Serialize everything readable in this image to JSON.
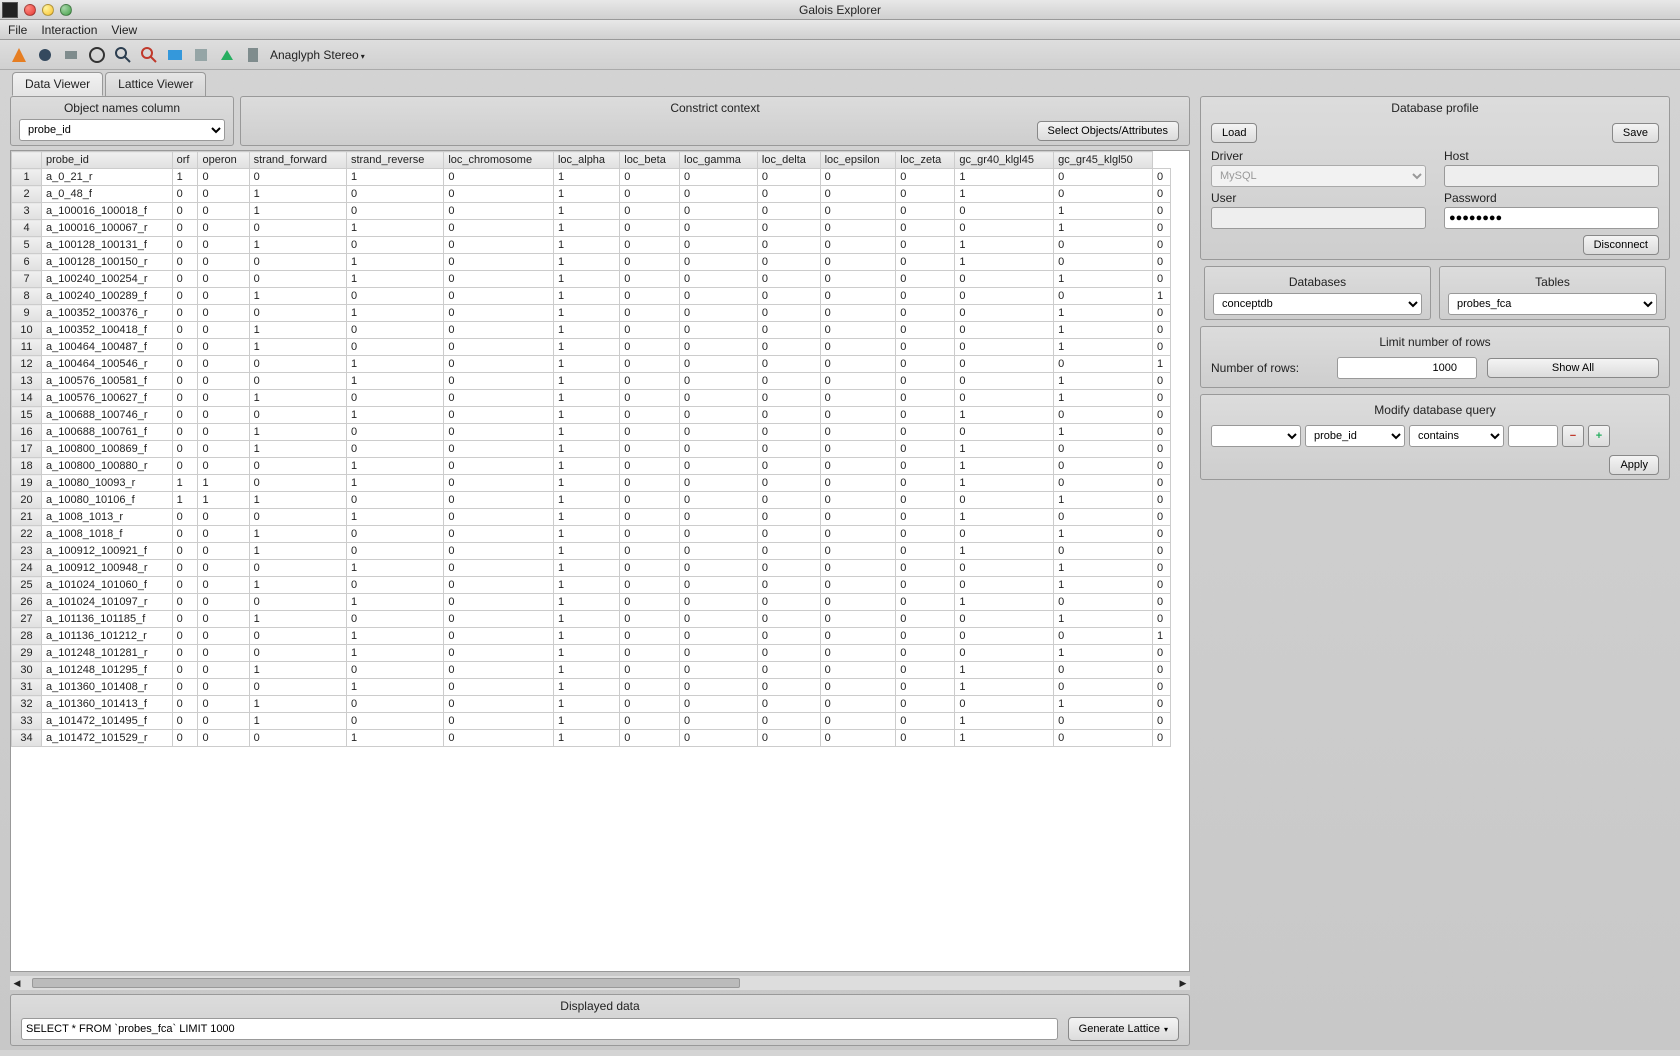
{
  "title": "Galois Explorer",
  "menus": [
    "File",
    "Interaction",
    "View"
  ],
  "toolbar_label": "Anaglyph Stereo",
  "tabs": [
    {
      "label": "Data Viewer",
      "active": true
    },
    {
      "label": "Lattice Viewer",
      "active": false
    }
  ],
  "object_names": {
    "label": "Object names column",
    "value": "probe_id"
  },
  "constrict": {
    "label": "Constrict context",
    "button": "Select Objects/Attributes"
  },
  "grid": {
    "columns": [
      "probe_id",
      "orf",
      "operon",
      "strand_forward",
      "strand_reverse",
      "loc_chromosome",
      "loc_alpha",
      "loc_beta",
      "loc_gamma",
      "loc_delta",
      "loc_epsilon",
      "loc_zeta",
      "gc_gr40_klgl45",
      "gc_gr45_klgl50"
    ],
    "rows": [
      [
        "a_0_21_r",
        "1",
        "0",
        "0",
        "1",
        "0",
        "1",
        "0",
        "0",
        "0",
        "0",
        "0",
        "1",
        "0",
        "0"
      ],
      [
        "a_0_48_f",
        "0",
        "0",
        "1",
        "0",
        "0",
        "1",
        "0",
        "0",
        "0",
        "0",
        "0",
        "1",
        "0",
        "0"
      ],
      [
        "a_100016_100018_f",
        "0",
        "0",
        "1",
        "0",
        "0",
        "1",
        "0",
        "0",
        "0",
        "0",
        "0",
        "0",
        "1",
        "0"
      ],
      [
        "a_100016_100067_r",
        "0",
        "0",
        "0",
        "1",
        "0",
        "1",
        "0",
        "0",
        "0",
        "0",
        "0",
        "0",
        "1",
        "0"
      ],
      [
        "a_100128_100131_f",
        "0",
        "0",
        "1",
        "0",
        "0",
        "1",
        "0",
        "0",
        "0",
        "0",
        "0",
        "1",
        "0",
        "0"
      ],
      [
        "a_100128_100150_r",
        "0",
        "0",
        "0",
        "1",
        "0",
        "1",
        "0",
        "0",
        "0",
        "0",
        "0",
        "1",
        "0",
        "0"
      ],
      [
        "a_100240_100254_r",
        "0",
        "0",
        "0",
        "1",
        "0",
        "1",
        "0",
        "0",
        "0",
        "0",
        "0",
        "0",
        "1",
        "0"
      ],
      [
        "a_100240_100289_f",
        "0",
        "0",
        "1",
        "0",
        "0",
        "1",
        "0",
        "0",
        "0",
        "0",
        "0",
        "0",
        "0",
        "1"
      ],
      [
        "a_100352_100376_r",
        "0",
        "0",
        "0",
        "1",
        "0",
        "1",
        "0",
        "0",
        "0",
        "0",
        "0",
        "0",
        "1",
        "0"
      ],
      [
        "a_100352_100418_f",
        "0",
        "0",
        "1",
        "0",
        "0",
        "1",
        "0",
        "0",
        "0",
        "0",
        "0",
        "0",
        "1",
        "0"
      ],
      [
        "a_100464_100487_f",
        "0",
        "0",
        "1",
        "0",
        "0",
        "1",
        "0",
        "0",
        "0",
        "0",
        "0",
        "0",
        "1",
        "0"
      ],
      [
        "a_100464_100546_r",
        "0",
        "0",
        "0",
        "1",
        "0",
        "1",
        "0",
        "0",
        "0",
        "0",
        "0",
        "0",
        "0",
        "1"
      ],
      [
        "a_100576_100581_f",
        "0",
        "0",
        "0",
        "1",
        "0",
        "1",
        "0",
        "0",
        "0",
        "0",
        "0",
        "0",
        "1",
        "0"
      ],
      [
        "a_100576_100627_f",
        "0",
        "0",
        "1",
        "0",
        "0",
        "1",
        "0",
        "0",
        "0",
        "0",
        "0",
        "0",
        "1",
        "0"
      ],
      [
        "a_100688_100746_r",
        "0",
        "0",
        "0",
        "1",
        "0",
        "1",
        "0",
        "0",
        "0",
        "0",
        "0",
        "1",
        "0",
        "0"
      ],
      [
        "a_100688_100761_f",
        "0",
        "0",
        "1",
        "0",
        "0",
        "1",
        "0",
        "0",
        "0",
        "0",
        "0",
        "0",
        "1",
        "0"
      ],
      [
        "a_100800_100869_f",
        "0",
        "0",
        "1",
        "0",
        "0",
        "1",
        "0",
        "0",
        "0",
        "0",
        "0",
        "1",
        "0",
        "0"
      ],
      [
        "a_100800_100880_r",
        "0",
        "0",
        "0",
        "1",
        "0",
        "1",
        "0",
        "0",
        "0",
        "0",
        "0",
        "1",
        "0",
        "0"
      ],
      [
        "a_10080_10093_r",
        "1",
        "1",
        "0",
        "1",
        "0",
        "1",
        "0",
        "0",
        "0",
        "0",
        "0",
        "1",
        "0",
        "0"
      ],
      [
        "a_10080_10106_f",
        "1",
        "1",
        "1",
        "0",
        "0",
        "1",
        "0",
        "0",
        "0",
        "0",
        "0",
        "0",
        "1",
        "0"
      ],
      [
        "a_1008_1013_r",
        "0",
        "0",
        "0",
        "1",
        "0",
        "1",
        "0",
        "0",
        "0",
        "0",
        "0",
        "1",
        "0",
        "0"
      ],
      [
        "a_1008_1018_f",
        "0",
        "0",
        "1",
        "0",
        "0",
        "1",
        "0",
        "0",
        "0",
        "0",
        "0",
        "0",
        "1",
        "0"
      ],
      [
        "a_100912_100921_f",
        "0",
        "0",
        "1",
        "0",
        "0",
        "1",
        "0",
        "0",
        "0",
        "0",
        "0",
        "1",
        "0",
        "0"
      ],
      [
        "a_100912_100948_r",
        "0",
        "0",
        "0",
        "1",
        "0",
        "1",
        "0",
        "0",
        "0",
        "0",
        "0",
        "0",
        "1",
        "0"
      ],
      [
        "a_101024_101060_f",
        "0",
        "0",
        "1",
        "0",
        "0",
        "1",
        "0",
        "0",
        "0",
        "0",
        "0",
        "0",
        "1",
        "0"
      ],
      [
        "a_101024_101097_r",
        "0",
        "0",
        "0",
        "1",
        "0",
        "1",
        "0",
        "0",
        "0",
        "0",
        "0",
        "1",
        "0",
        "0"
      ],
      [
        "a_101136_101185_f",
        "0",
        "0",
        "1",
        "0",
        "0",
        "1",
        "0",
        "0",
        "0",
        "0",
        "0",
        "0",
        "1",
        "0"
      ],
      [
        "a_101136_101212_r",
        "0",
        "0",
        "0",
        "1",
        "0",
        "1",
        "0",
        "0",
        "0",
        "0",
        "0",
        "0",
        "0",
        "1"
      ],
      [
        "a_101248_101281_r",
        "0",
        "0",
        "0",
        "1",
        "0",
        "1",
        "0",
        "0",
        "0",
        "0",
        "0",
        "0",
        "1",
        "0"
      ],
      [
        "a_101248_101295_f",
        "0",
        "0",
        "1",
        "0",
        "0",
        "1",
        "0",
        "0",
        "0",
        "0",
        "0",
        "1",
        "0",
        "0"
      ],
      [
        "a_101360_101408_r",
        "0",
        "0",
        "0",
        "1",
        "0",
        "1",
        "0",
        "0",
        "0",
        "0",
        "0",
        "1",
        "0",
        "0"
      ],
      [
        "a_101360_101413_f",
        "0",
        "0",
        "1",
        "0",
        "0",
        "1",
        "0",
        "0",
        "0",
        "0",
        "0",
        "0",
        "1",
        "0"
      ],
      [
        "a_101472_101495_f",
        "0",
        "0",
        "1",
        "0",
        "0",
        "1",
        "0",
        "0",
        "0",
        "0",
        "0",
        "1",
        "0",
        "0"
      ],
      [
        "a_101472_101529_r",
        "0",
        "0",
        "0",
        "1",
        "0",
        "1",
        "0",
        "0",
        "0",
        "0",
        "0",
        "1",
        "0",
        "0"
      ]
    ]
  },
  "displayed": {
    "label": "Displayed data",
    "query": "SELECT * FROM `probes_fca` LIMIT 1000",
    "generate": "Generate Lattice"
  },
  "db_profile": {
    "title": "Database profile",
    "load": "Load",
    "save": "Save",
    "driver_label": "Driver",
    "driver_value": "MySQL",
    "host_label": "Host",
    "host_value": "",
    "user_label": "User",
    "user_value": "",
    "password_label": "Password",
    "password_value": "●●●●●●●●",
    "disconnect": "Disconnect"
  },
  "databases": {
    "label": "Databases",
    "value": "conceptdb"
  },
  "tables_sec": {
    "label": "Tables",
    "value": "probes_fca"
  },
  "limit": {
    "title": "Limit number of rows",
    "label": "Number of rows:",
    "value": "1000",
    "show_all": "Show All"
  },
  "modify": {
    "title": "Modify database query",
    "col1": "",
    "col2": "probe_id",
    "op": "contains",
    "val": "",
    "apply": "Apply"
  }
}
